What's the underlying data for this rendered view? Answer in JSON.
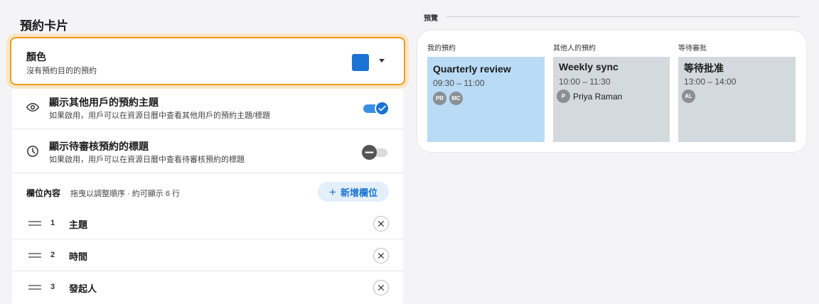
{
  "page": {
    "title": "預約卡片"
  },
  "color_setting": {
    "title": "顏色",
    "subtitle": "沒有預約目的的預約",
    "swatch_color": "#1a73d4"
  },
  "toggles": [
    {
      "icon": "eye-icon",
      "title": "顯示其他用戶的預約主題",
      "description": "如果啟用，用戶可以在資源日曆中查看其他用戶的預約主題/標題",
      "enabled": true
    },
    {
      "icon": "clock-icon",
      "title": "顯示待審核預約的標題",
      "description": "如果啟用，用戶可以在資源日曆中查看待審核預約的標題",
      "enabled": false
    }
  ],
  "fields": {
    "label": "欄位內容",
    "hint": "拖曳以調整順序 · 約可顯示 6 行",
    "add_button": "新增欄位",
    "items": [
      {
        "index": "1",
        "name": "主題"
      },
      {
        "index": "2",
        "name": "時間"
      },
      {
        "index": "3",
        "name": "發起人"
      }
    ]
  },
  "preview": {
    "label": "預覽",
    "columns": [
      {
        "heading": "我的預約",
        "title": "Quarterly review",
        "time": "09:30 – 11:00",
        "avatars": [
          "PR",
          "MC"
        ],
        "color": "#b9dbf6"
      },
      {
        "heading": "其他人的預約",
        "title": "Weekly sync",
        "time": "10:00 – 11:30",
        "avatars": [
          "P"
        ],
        "avatar_name": "Priya Raman",
        "color": "#d4d9dd"
      },
      {
        "heading": "等待審批",
        "title": "等待批准",
        "time": "13:00 – 14:00",
        "avatars": [
          "AL"
        ],
        "color": "#d4d9dd"
      }
    ]
  },
  "colors": {
    "accent": "#1a73d4",
    "focus_outline": "#f29a1c"
  }
}
